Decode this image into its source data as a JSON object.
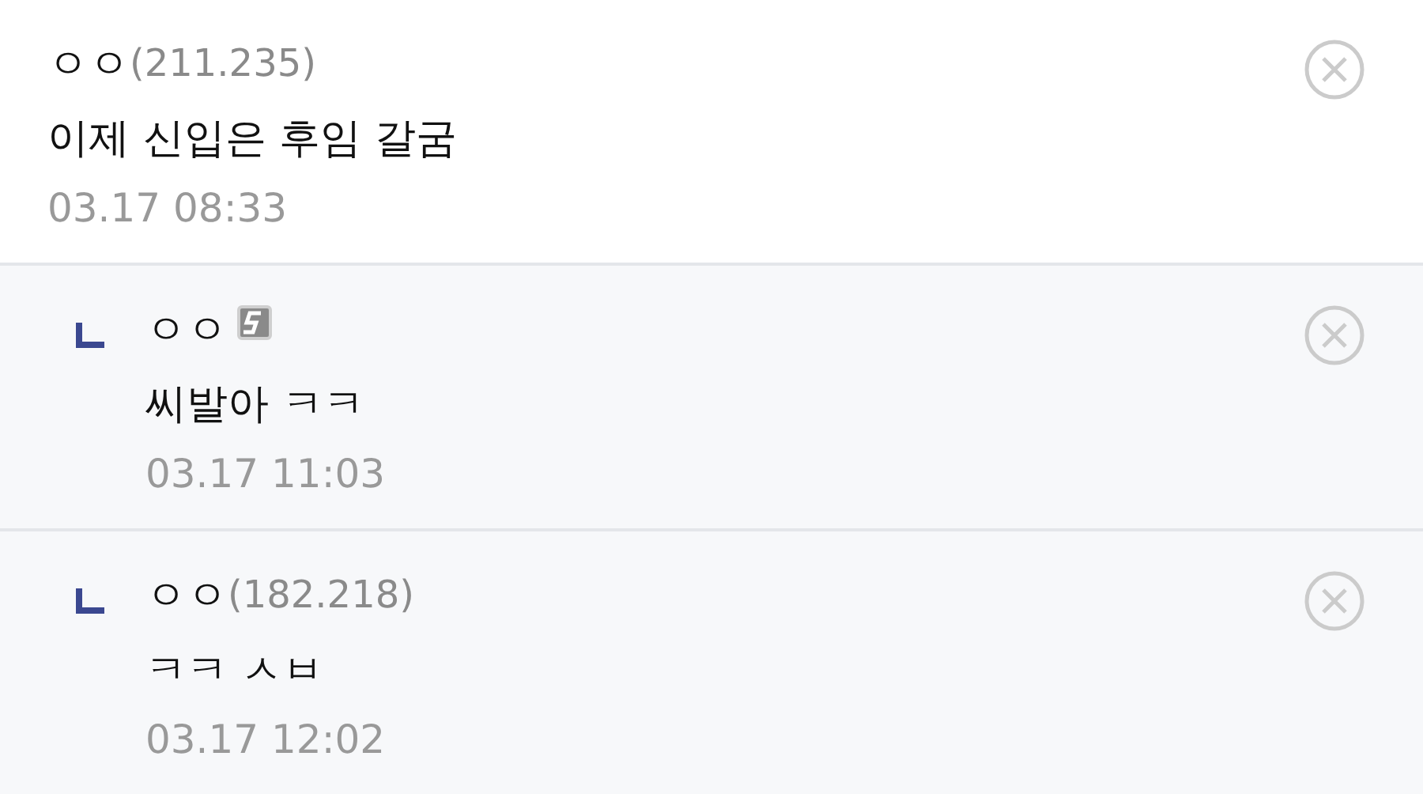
{
  "comments": [
    {
      "kind": "comment",
      "name": "ㅇㅇ",
      "ip": "(211.235)",
      "member_icon": false,
      "text": "이제 신입은 후임 갈굼",
      "date": "03.17 08:33"
    },
    {
      "kind": "reply",
      "name": "ㅇㅇ",
      "member_icon": true,
      "text": "씨발아 ㅋㅋ",
      "date": "03.17 11:03"
    },
    {
      "kind": "reply",
      "name": "ㅇㅇ",
      "ip": "(182.218)",
      "member_icon": false,
      "text": "ㅋㅋ ㅅㅂ",
      "date": "03.17 12:02"
    }
  ]
}
